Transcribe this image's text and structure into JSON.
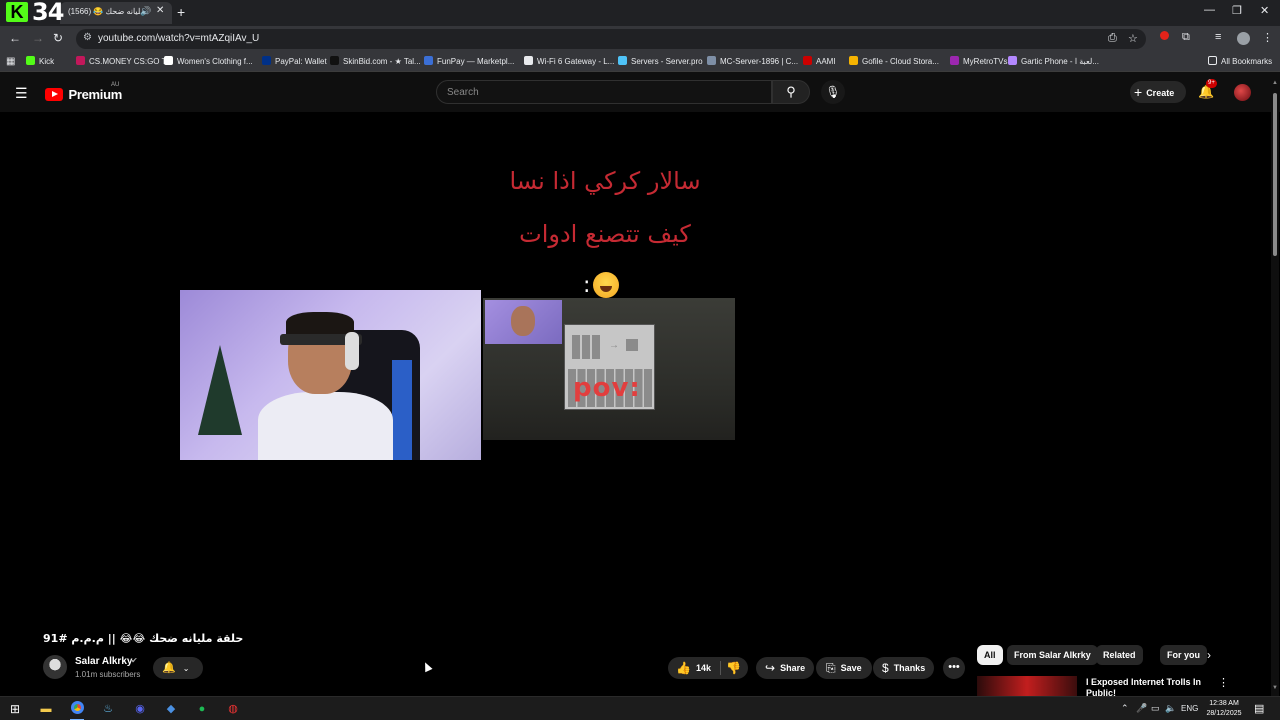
{
  "browser": {
    "overlay_logo": {
      "k": "K",
      "text": "34"
    },
    "tab": {
      "title": "حلقة مليانه ضحك 😂 (1566)",
      "close": "✕"
    },
    "new_tab": "+",
    "window_controls": {
      "minimize": "—",
      "maximize": "❐",
      "close": "✕"
    },
    "address": {
      "url": "youtube.com/watch?v=mtAZqiIAv_U"
    },
    "bookmarks": [
      {
        "label": "Kick",
        "color": "#53fc18"
      },
      {
        "label": "CS.MONEY CS:GO T...",
        "color": "#c2185b"
      },
      {
        "label": "Women's Clothing f...",
        "color": "#ffffff"
      },
      {
        "label": "PayPal: Wallet",
        "color": "#003087"
      },
      {
        "label": "SkinBid.com - ★ Tal...",
        "color": "#111111"
      },
      {
        "label": "FunPay — Marketpl...",
        "color": "#3b6fd6"
      },
      {
        "label": "Wi-Fi 6 Gateway - L...",
        "color": "#e8eaed"
      },
      {
        "label": "Servers - Server.pro",
        "color": "#4fc3f7"
      },
      {
        "label": "MC-Server-1896 | C...",
        "color": "#7e8fa6"
      },
      {
        "label": "AAMI",
        "color": "#cc0000"
      },
      {
        "label": "Gofile - Cloud Stora...",
        "color": "#f5b301"
      },
      {
        "label": "MyRetroTVs",
        "color": "#9c27b0"
      },
      {
        "label": "Gartic Phone - لعبة ا...",
        "color": "#b388ff"
      }
    ],
    "all_bookmarks": "All Bookmarks"
  },
  "youtube": {
    "logo_text": "Premium",
    "country_code": "AU",
    "search": {
      "placeholder": "Search"
    },
    "create_label": "Create",
    "notif_badge": "9+"
  },
  "video": {
    "overlay_line1": "سالار كركي اذا نسا",
    "overlay_line2": "كيف تتصنع ادوات",
    "overlay_line3": ":",
    "game_caption": "pov:",
    "title": "حلقة مليانه ضحك 😂😂 || م.م.م #91",
    "channel": {
      "name": "Salar Alkrky",
      "subscribers": "1.01m subscribers"
    },
    "likes": "14k",
    "actions": {
      "share": "Share",
      "save": "Save",
      "thanks": "Thanks"
    }
  },
  "sidebar": {
    "chips": [
      {
        "label": "All",
        "active": true
      },
      {
        "label": "From Salar Alkrky",
        "active": false
      },
      {
        "label": "Related",
        "active": false
      },
      {
        "label": "For you",
        "active": false
      }
    ],
    "recommendation": {
      "title": "I Exposed Internet Trolls In Public!"
    }
  },
  "taskbar": {
    "language": "ENG",
    "time": "12:38 AM",
    "date": "28/12/2025"
  }
}
